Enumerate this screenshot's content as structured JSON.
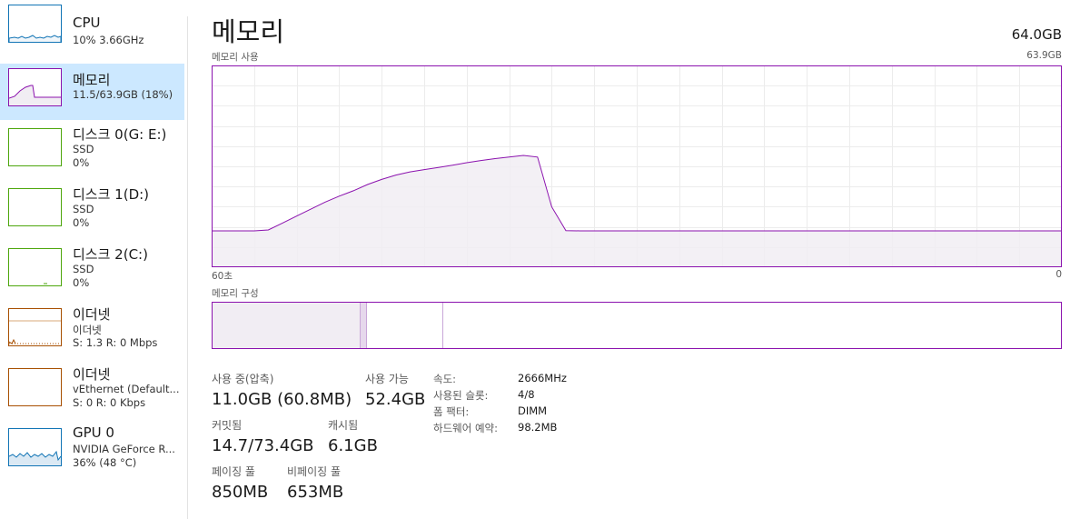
{
  "sidebar": {
    "items": [
      {
        "title": "CPU",
        "line1": "10% 3.66GHz",
        "line2": "",
        "selected": false,
        "color": "#1174b5"
      },
      {
        "title": "메모리",
        "line1": "11.5/63.9GB (18%)",
        "line2": "",
        "selected": true,
        "color": "#8b12ae"
      },
      {
        "title": "디스크 0(G: E:)",
        "line1": "SSD",
        "line2": "0%",
        "selected": false,
        "color": "#4da60c"
      },
      {
        "title": "디스크 1(D:)",
        "line1": "SSD",
        "line2": "0%",
        "selected": false,
        "color": "#4da60c"
      },
      {
        "title": "디스크 2(C:)",
        "line1": "SSD",
        "line2": "0%",
        "selected": false,
        "color": "#4da60c"
      },
      {
        "title": "이더넷",
        "line1": "이더넷",
        "line2": "S: 1.3  R: 0 Mbps",
        "selected": false,
        "color": "#a74f01"
      },
      {
        "title": "이더넷",
        "line1": "vEthernet (Default...",
        "line2": "S: 0  R: 0 Kbps",
        "selected": false,
        "color": "#a74f01"
      },
      {
        "title": "GPU 0",
        "line1": "NVIDIA GeForce R...",
        "line2": "36% (48 °C)",
        "selected": false,
        "color": "#1174b5"
      }
    ]
  },
  "main": {
    "title": "메모리",
    "total": "64.0GB",
    "usage_label": "메모리 사용",
    "usage_max": "63.9GB",
    "axis_left": "60초",
    "axis_right": "0",
    "composition_label": "메모리 구성"
  },
  "chart_data": {
    "type": "area",
    "title": "메모리 사용",
    "xlabel": "",
    "ylabel": "",
    "x_range_seconds": [
      60,
      0
    ],
    "ylim": [
      0,
      63.9
    ],
    "unit": "GB",
    "grid": true,
    "color": "#8b12ae",
    "fill": "#f1edf3",
    "series": [
      {
        "values": [
          11.5,
          11.5,
          11.5,
          11.5,
          11.8,
          14.0,
          16.2,
          18.4,
          20.6,
          22.5,
          24.2,
          26.2,
          27.8,
          29.2,
          30.2,
          30.9,
          31.6,
          32.3,
          33.1,
          33.8,
          34.4,
          34.9,
          35.4,
          34.9,
          19.1,
          11.6,
          11.5,
          11.5,
          11.5,
          11.5,
          11.5,
          11.5,
          11.5,
          11.5,
          11.5,
          11.5,
          11.5,
          11.5,
          11.5,
          11.5,
          11.5,
          11.5,
          11.5,
          11.5,
          11.5,
          11.5,
          11.5,
          11.5,
          11.5,
          11.5,
          11.5,
          11.5,
          11.5,
          11.5,
          11.5,
          11.5,
          11.5,
          11.5,
          11.5,
          11.5,
          11.5
        ]
      }
    ]
  },
  "composition": {
    "segments": [
      {
        "fraction": 0.175,
        "fill": "#f1edf3"
      },
      {
        "fraction": 0.008,
        "fill": "#e6d8ec"
      },
      {
        "fraction": 0.09,
        "fill": "#ffffff"
      },
      {
        "fraction": 0.727,
        "fill": "#ffffff"
      }
    ]
  },
  "stats": {
    "in_use_label": "사용 중(압축)",
    "in_use_value": "11.0GB (60.8MB)",
    "available_label": "사용 가능",
    "available_value": "52.4GB",
    "committed_label": "커밋됨",
    "committed_value": "14.7/73.4GB",
    "cached_label": "캐시됨",
    "cached_value": "6.1GB",
    "paged_label": "페이징 풀",
    "paged_value": "850MB",
    "nonpaged_label": "비페이징 풀",
    "nonpaged_value": "653MB"
  },
  "details": [
    {
      "label": "속도:",
      "value": "2666MHz"
    },
    {
      "label": "사용된 슬롯:",
      "value": "4/8"
    },
    {
      "label": "폼 팩터:",
      "value": "DIMM"
    },
    {
      "label": "하드웨어 예약:",
      "value": "98.2MB"
    }
  ]
}
